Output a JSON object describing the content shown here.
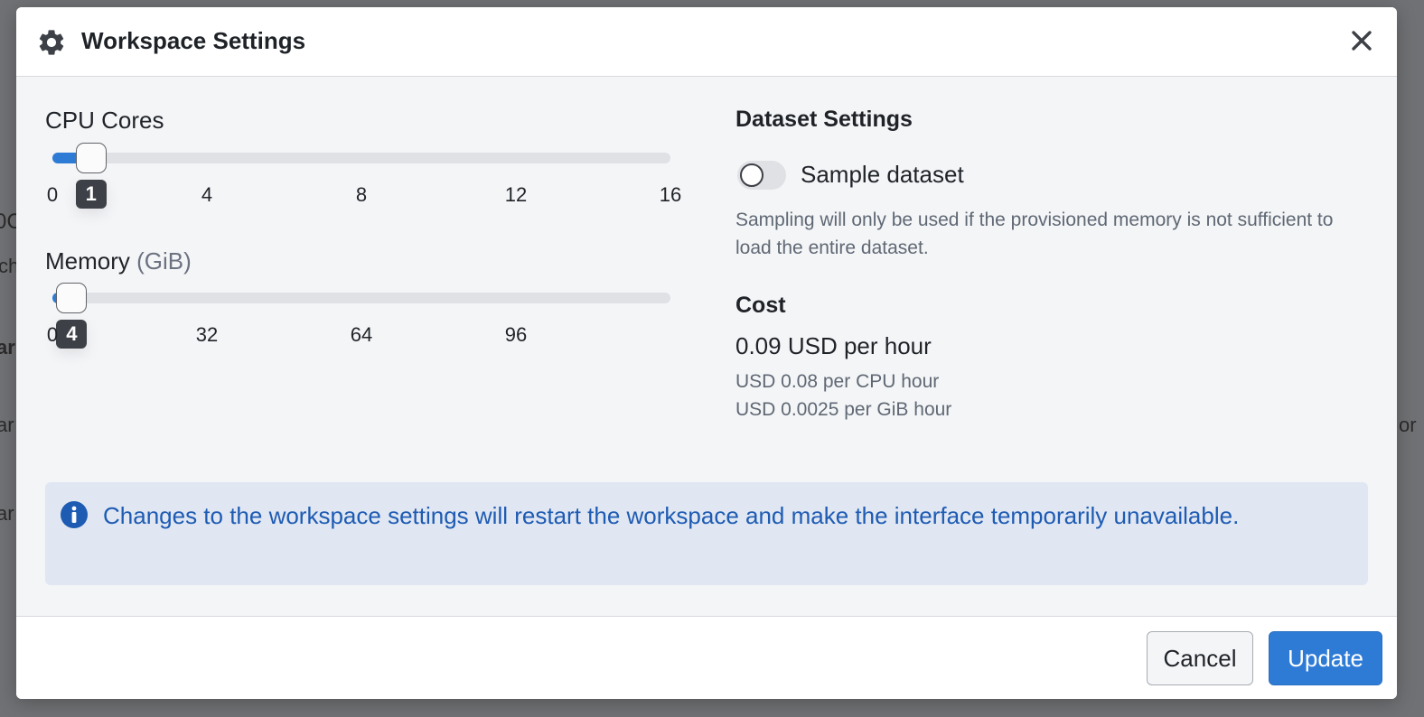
{
  "background": {
    "fragments": [
      "0C",
      "ch",
      "ar",
      "ar",
      "ar",
      "or"
    ]
  },
  "modal": {
    "title": "Workspace Settings",
    "icon": "gear-icon",
    "close_icon": "close-icon"
  },
  "cpu": {
    "label": "CPU Cores",
    "ticks": [
      "0",
      "4",
      "8",
      "12",
      "16"
    ],
    "min": 0,
    "max": 16,
    "value": 1,
    "value_label": "1"
  },
  "memory": {
    "label": "Memory",
    "unit": "(GiB)",
    "ticks": [
      "0",
      "32",
      "64",
      "96"
    ],
    "min": 0,
    "max": 128,
    "value": 4,
    "value_label": "4"
  },
  "dataset": {
    "title": "Dataset Settings",
    "toggle_label": "Sample dataset",
    "toggle_on": false,
    "help": "Sampling will only be used if the provisioned memory is not sufficient to load the entire dataset."
  },
  "cost": {
    "title": "Cost",
    "total": "0.09 USD per hour",
    "cpu_rate": "USD 0.08 per CPU hour",
    "mem_rate": "USD 0.0025 per GiB hour"
  },
  "info": {
    "icon": "info-icon",
    "text": "Changes to the workspace settings will restart the workspace and make the interface temporarily unavailable."
  },
  "footer": {
    "cancel_label": "Cancel",
    "update_label": "Update"
  },
  "colors": {
    "accent": "#2e7bd6",
    "info_bg": "#e0e7f2",
    "info_text": "#1e5bb3"
  }
}
